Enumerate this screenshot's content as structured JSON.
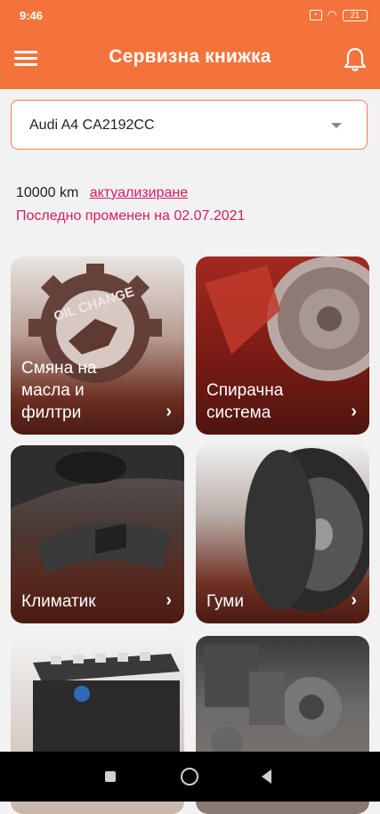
{
  "status_bar": {
    "time": "9:46",
    "battery": "21"
  },
  "app_bar": {
    "title": "Сервизна книжка"
  },
  "car_select": {
    "selected": "Audi A4 CA2192CC"
  },
  "mileage": {
    "value": "10000 km",
    "update_link": "актуализиране",
    "last_modified": "Последно променен на 02.07.2021"
  },
  "categories": [
    {
      "label": "Смяна на масла и филтри",
      "arrow": "›"
    },
    {
      "label": "Спирачна система",
      "arrow": "›"
    },
    {
      "label": "Климатик",
      "arrow": "›"
    },
    {
      "label": "Гуми",
      "arrow": "›"
    },
    {
      "label": "",
      "arrow": ""
    },
    {
      "label": "",
      "arrow": "›"
    }
  ],
  "oil_change_art_text": "OIL CHANGE",
  "colors": {
    "primary": "#f4733a",
    "link": "#d81b60"
  }
}
